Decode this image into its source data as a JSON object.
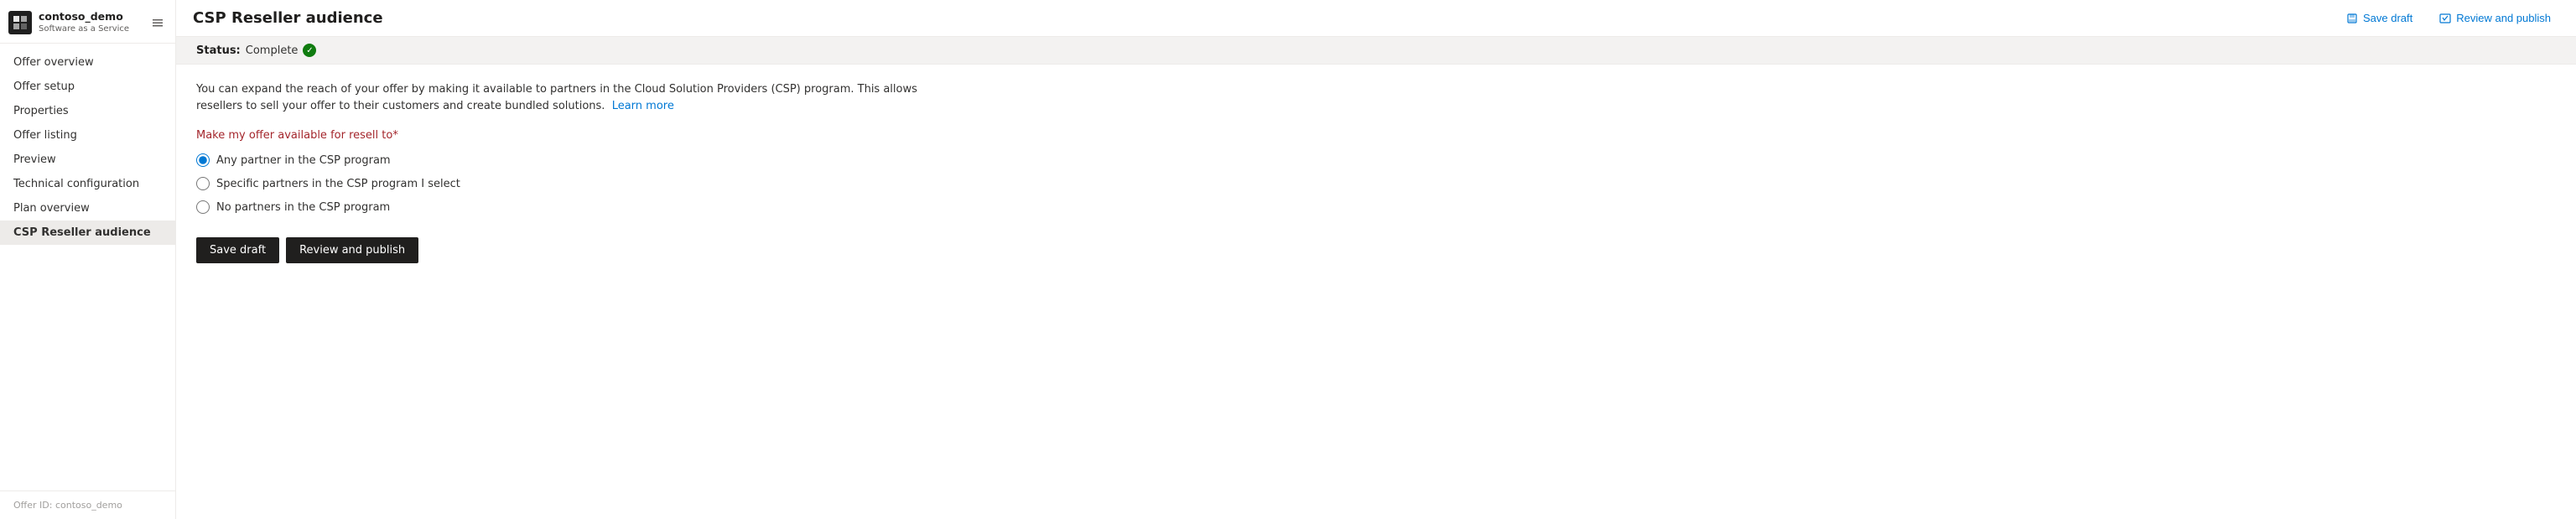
{
  "brand": {
    "name": "contoso_demo",
    "subtitle": "Software as a Service",
    "icon_label": "brand-icon"
  },
  "sidebar": {
    "items": [
      {
        "id": "offer-overview",
        "label": "Offer overview",
        "active": false
      },
      {
        "id": "offer-setup",
        "label": "Offer setup",
        "active": false
      },
      {
        "id": "properties",
        "label": "Properties",
        "active": false
      },
      {
        "id": "offer-listing",
        "label": "Offer listing",
        "active": false
      },
      {
        "id": "preview",
        "label": "Preview",
        "active": false
      },
      {
        "id": "technical-configuration",
        "label": "Technical configuration",
        "active": false
      },
      {
        "id": "plan-overview",
        "label": "Plan overview",
        "active": false
      },
      {
        "id": "csp-reseller-audience",
        "label": "CSP Reseller audience",
        "active": true
      }
    ],
    "footer_label": "Offer ID: contoso_demo"
  },
  "header": {
    "title": "CSP Reseller audience",
    "save_draft_label": "Save draft",
    "review_publish_label": "Review and publish"
  },
  "status": {
    "prefix": "Status:",
    "value": "Complete",
    "icon_char": "✓"
  },
  "page": {
    "description_part1": "You can expand the reach of your offer by making it available to partners in the Cloud Solution Providers (CSP) program. This allows resellers to sell your offer to their customers and create bundled solutions.",
    "learn_more_label": "Learn more",
    "section_label": "Make my offer available for resell to",
    "section_required": "*",
    "radio_options": [
      {
        "id": "any-partner",
        "label": "Any partner in the CSP program",
        "checked": true
      },
      {
        "id": "specific-partners",
        "label": "Specific partners in the CSP program I select",
        "checked": false
      },
      {
        "id": "no-partners",
        "label": "No partners in the CSP program",
        "checked": false
      }
    ],
    "save_draft_btn": "Save draft",
    "review_publish_btn": "Review and publish"
  }
}
